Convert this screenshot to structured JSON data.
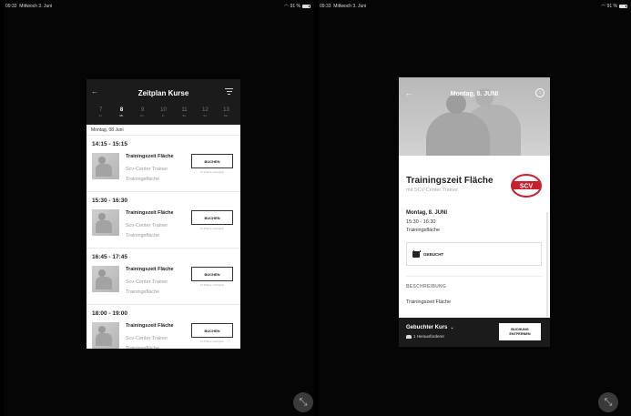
{
  "left_status": {
    "time": "09:32",
    "date": "Mittwoch 3. Juni",
    "battery": "91 %"
  },
  "right_status": {
    "time": "09:33",
    "date": "Mittwoch 3. Juni",
    "battery": "91 %"
  },
  "card1": {
    "title": "Zeitplan Kurse",
    "days": [
      {
        "num": "7",
        "wd": "Di."
      },
      {
        "num": "8",
        "wd": "Mi."
      },
      {
        "num": "9",
        "wd": "Do."
      },
      {
        "num": "10",
        "wd": "Fr."
      },
      {
        "num": "11",
        "wd": "Sa."
      },
      {
        "num": "12",
        "wd": "So."
      },
      {
        "num": "13",
        "wd": "Mo."
      }
    ],
    "selected_day_index": 1,
    "date_line": "Montag, 08 Juni",
    "slots": [
      {
        "time": "14:15 - 15:15",
        "name": "Trainingszeit Fläche",
        "trainer": "Scv-Center Trainer",
        "area": "Trainingsfläche",
        "button": "BUCHEN",
        "avail": "15 Plätze verfügbar"
      },
      {
        "time": "15:30 - 16:30",
        "name": "Trainingszeit Fläche",
        "trainer": "Scv-Center Trainer",
        "area": "Trainingsfläche",
        "button": "BUCHEN",
        "avail": "15 Plätze verfügbar"
      },
      {
        "time": "16:45 - 17:45",
        "name": "Trainingszeit Fläche",
        "trainer": "Scv-Center Trainer",
        "area": "Trainingsfläche",
        "button": "BUCHEN",
        "avail": "15 Plätze verfügbar"
      },
      {
        "time": "18:00 - 19:00",
        "name": "Trainingszeit Fläche",
        "trainer": "Scv-Center Trainer",
        "area": "Trainingsfläche",
        "button": "BUCHEN",
        "avail": "15 Plätze verfügbar"
      }
    ]
  },
  "card2": {
    "header_title": "Montag, 8. JUNI",
    "course_title": "Trainingszeit Fläche",
    "trainer": "mit SCV-Center Trainer",
    "logo_text": "SCV",
    "date": "Montag, 8. JUNI",
    "time": "15:30 - 16:30",
    "area": "Trainingsfläche",
    "status": "GEBUCHT",
    "desc_label": "BESCHREIBUNG",
    "desc_text": "Trainingszeit Fläche",
    "footer_title": "Gebuchter Kurs",
    "footer_count": "1 Herausforderer",
    "remove_line1": "BUCHUNG",
    "remove_line2": "ENTFERNEN"
  },
  "icons": {
    "expand": "expand-arrows-icon",
    "back": "back-arrow-icon",
    "filter": "filter-icon",
    "wifi": "wifi-icon",
    "calendar": "calendar-icon",
    "people": "people-icon"
  }
}
